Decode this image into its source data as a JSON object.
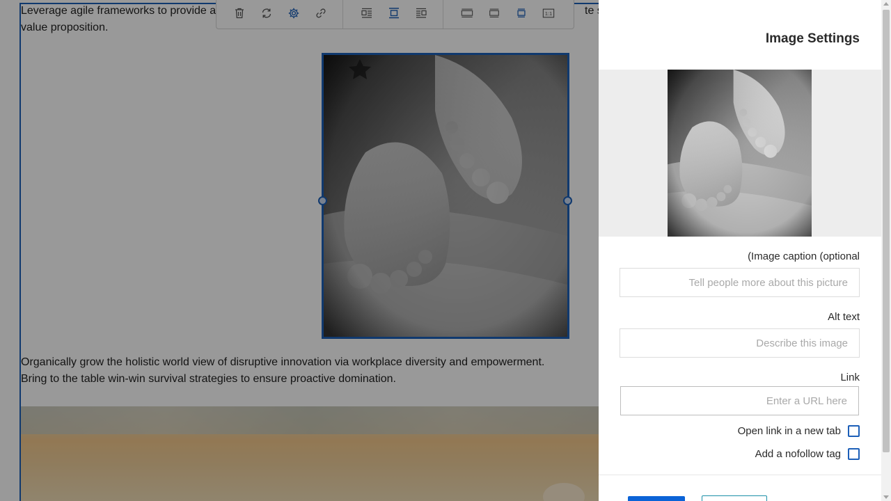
{
  "editor": {
    "paragraph1": {
      "line1_start": "Leverage agile frameworks to provide a",
      "line1_end": "te stra",
      "line2": "value proposition."
    },
    "paragraph2": {
      "line1": "Organically grow the holistic world view of disruptive innovation via workplace diversity and empowerment.",
      "line2": "Bring to the table win-win survival strategies to ensure proactive domination."
    }
  },
  "toolbar": {
    "groups": [
      [
        "trash-icon",
        "replace-icon",
        "gear-icon",
        "link-icon"
      ],
      [
        "align-left-icon",
        "align-center-icon",
        "align-right-icon"
      ],
      [
        "size-full-icon",
        "size-wide-icon",
        "size-best-fit-icon",
        "size-original-icon"
      ]
    ],
    "active": [
      "gear-icon",
      "align-center-icon",
      "size-best-fit-icon"
    ],
    "original_size_glyph": "1:1"
  },
  "panel": {
    "title": "Image Settings",
    "caption_label": "(Image caption (optional",
    "caption_placeholder": "Tell people more about this picture",
    "alt_label": "Alt text",
    "alt_placeholder": "Describe this image",
    "link_label": "Link",
    "link_placeholder": "Enter a URL here",
    "new_tab_label": "Open link in a new tab",
    "nofollow_label": "Add a nofollow tag",
    "new_tab_checked": false,
    "nofollow_checked": false
  },
  "colors": {
    "accent": "#1c5fb8",
    "primary_button": "#0b63d7",
    "overlay": "rgba(0,0,0,0.40)",
    "preview_background": "#ededed"
  }
}
